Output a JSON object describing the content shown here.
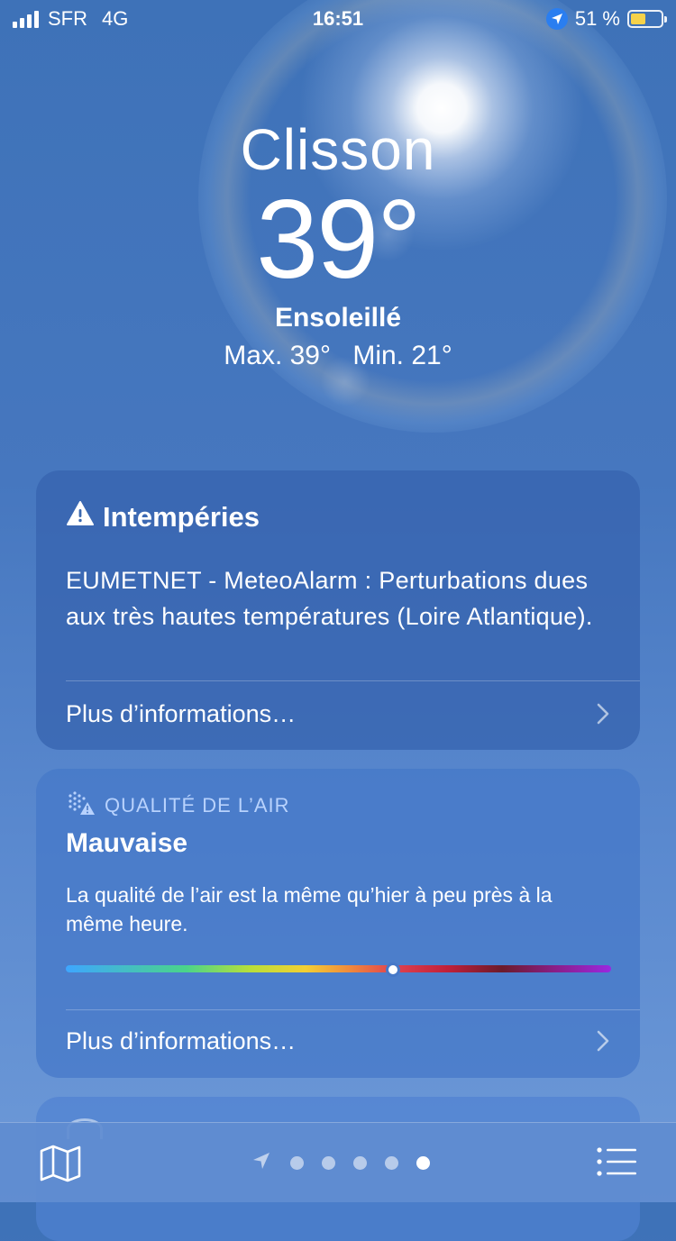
{
  "status_bar": {
    "carrier": "SFR",
    "network": "4G",
    "time": "16:51",
    "battery_percent": "51 %",
    "battery_level": 0.51,
    "battery_color": "#f6d24a"
  },
  "weather": {
    "city": "Clisson",
    "temperature": "39°",
    "condition": "Ensoleillé",
    "max": "Max. 39°",
    "min": "Min. 21°"
  },
  "alert_card": {
    "icon": "warning-icon",
    "title": "Intempéries",
    "text": "EUMETNET - MeteoAlarm : Perturbations dues aux très hautes températures (Loire Atlantique).",
    "more": "Plus d’informations…"
  },
  "air_quality_card": {
    "icon": "air-quality-icon",
    "header": "QUALITÉ DE L’AIR",
    "level": "Mauvaise",
    "description": "La qualité de l’air est la même qu’hier à peu près à la même heure.",
    "scale_position": 0.6,
    "more": "Plus d’informations…"
  },
  "toolbar": {
    "map_icon": "map-icon",
    "list_icon": "list-icon",
    "location_icon": "location-arrow-icon",
    "page_count": 5,
    "active_page": 5
  },
  "colors": {
    "sky_top": "#3e72b8",
    "sky_bottom": "#6e9ad8",
    "location_badge": "#2a7ef0"
  }
}
